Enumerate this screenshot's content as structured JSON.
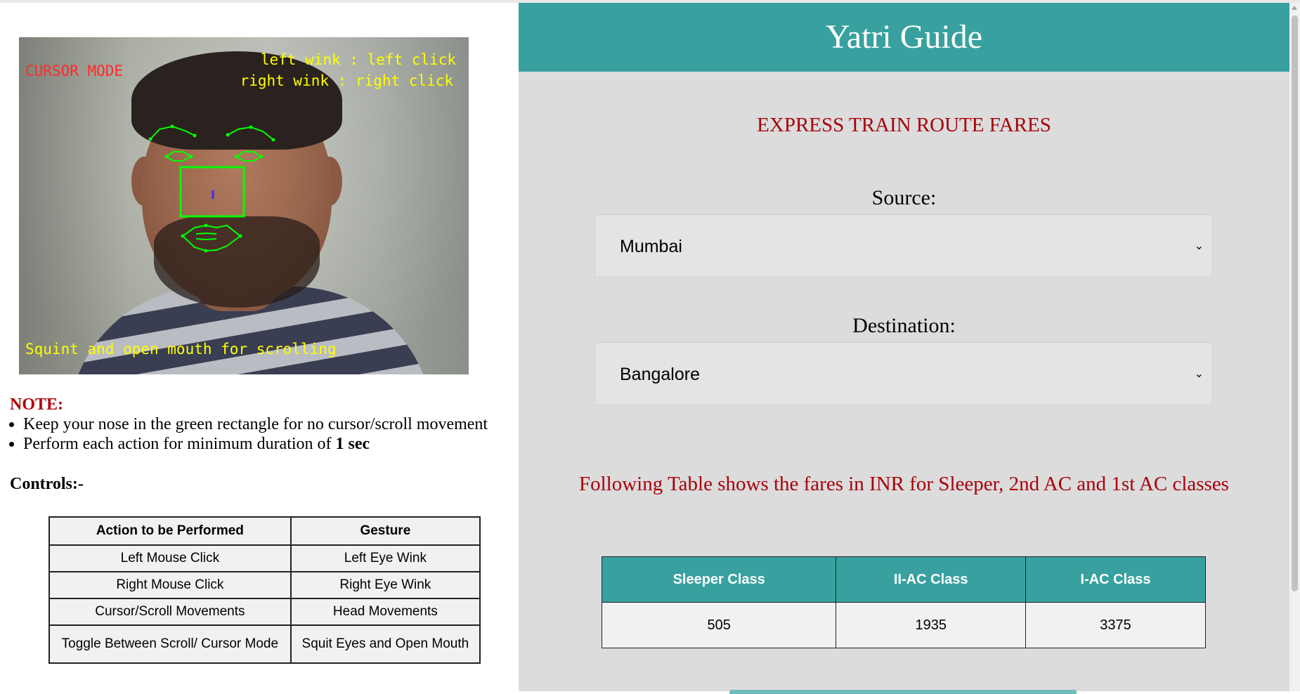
{
  "camera": {
    "mode_label": "CURSOR MODE",
    "left_wink_hint": "left wink : left click",
    "right_wink_hint": "right wink : right click",
    "scroll_hint": "Squint and open mouth for scrolling"
  },
  "note": {
    "title": "NOTE:",
    "items": [
      "Keep your nose in the green rectangle for no cursor/scroll movement",
      "Perform each action for minimum duration of "
    ],
    "duration_bold": "1 sec"
  },
  "controls": {
    "title": "Controls:-",
    "headers": [
      "Action to be Performed",
      "Gesture"
    ],
    "rows": [
      [
        "Left Mouse Click",
        "Left Eye Wink"
      ],
      [
        "Right Mouse Click",
        "Right Eye Wink"
      ],
      [
        "Cursor/Scroll Movements",
        "Head Movements"
      ],
      [
        "Toggle Between Scroll/ Cursor Mode",
        "Squit Eyes and Open Mouth"
      ]
    ]
  },
  "app": {
    "title": "Yatri Guide",
    "subtitle": "EXPRESS TRAIN ROUTE FARES",
    "source_label": "Source:",
    "source_value": "Mumbai",
    "destination_label": "Destination:",
    "destination_value": "Bangalore",
    "info_text": "Following Table shows the fares in INR for Sleeper, 2nd AC and 1st AC classes",
    "fares": {
      "headers": [
        "Sleeper Class",
        "II-AC Class",
        "I-AC Class"
      ],
      "values": [
        "505",
        "1935",
        "3375"
      ]
    }
  },
  "colors": {
    "accent": "#38a19f",
    "heading_red": "#a8000a",
    "panel_bg": "#dcdcdc",
    "landmark_green": "#00ff00",
    "overlay_yellow": "#ffff00",
    "mode_red": "#ff2a2a"
  },
  "icons": {
    "select_chevron": "chevron-down-icon",
    "scroll_up": "scroll-up-arrow-icon"
  }
}
